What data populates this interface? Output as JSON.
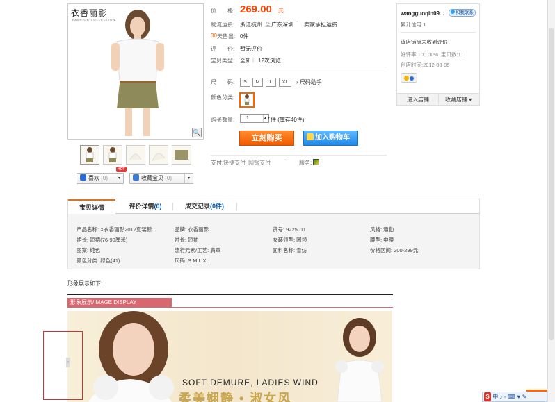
{
  "gallery": {
    "brand_logo": "衣香丽影",
    "brand_sub": "FASHION COLLECTION",
    "zoom_icon": "magnifier-icon",
    "thumbnail_count": 5
  },
  "actions": {
    "like_label": "喜欢",
    "like_count": "(0)",
    "fav_label": "收藏宝贝",
    "fav_count": "(0)",
    "hot_badge": "HOT"
  },
  "info": {
    "price_label": "价　　格:",
    "price": "269.00",
    "price_unit": "元",
    "shipping_label": "物流运费:",
    "shipping_from": "浙江杭州",
    "shipping_sep1": "至",
    "shipping_to": "广东深圳",
    "shipping_note": "卖家承担运费",
    "sold_days": "30",
    "sold_label": "天售出:",
    "sold_count": "0件",
    "review_label": "评　　价:",
    "review_value": "暂无评价",
    "type_label": "宝贝类型:",
    "type_value": "全新",
    "views": "12次浏览",
    "size_label": "尺　　码:",
    "sizes": [
      "S",
      "M",
      "L",
      "XL"
    ],
    "size_helper": "尺码助手",
    "color_label": "颜色分类:",
    "qty_label": "购买数量:",
    "qty_value": "1",
    "stock": "件 (库存40件)",
    "buy_now": "立刻购买",
    "add_to_cart": "加入购物车",
    "pay_label": "支付:",
    "pay_quick": "快捷支付",
    "pay_bank": "网银支付",
    "service_label": "服务:"
  },
  "shop": {
    "seller": "wangguoqin09...",
    "contact": "和我联系",
    "credit_label": "累计信用:",
    "credit_value": "1",
    "no_review": "该店铺尚未收到评价",
    "positive_rate": "好评率:100.00%",
    "item_count": "宝贝数:11",
    "created": "创店时间:2012-03-05",
    "enter_shop": "进入店铺",
    "fav_shop": "收藏店铺"
  },
  "tabs": [
    {
      "label": "宝贝详情",
      "count": ""
    },
    {
      "label": "评价详情",
      "count": "(0)"
    },
    {
      "label": "成交记录",
      "count": "(0件)"
    }
  ],
  "attributes": [
    [
      "产品名称: X衣香丽影2012夏装新...",
      "品牌: 衣香丽影",
      "货号: 9225011",
      "风格: 通勤"
    ],
    [
      "裙长: 短裙(76-90厘米)",
      "袖长: 短袖",
      "女装领型: 圆领",
      "腰型: 中腰"
    ],
    [
      "图案: 纯色",
      "流行元素/工艺: 肩章",
      "面料名称: 雪纺",
      "价格区间: 200-299元"
    ],
    [
      "颜色分类: 绿色(41)",
      "尺码: S M L XL",
      "",
      ""
    ]
  ],
  "showcase": {
    "intro": "形象展示如下:",
    "tag": "形象展示/IMAGE DISPLAY",
    "slogan_en": "SOFT DEMURE, LADIES WIND",
    "slogan_zh": "柔美娴静 • 淑女风"
  },
  "ime": {
    "logo": "S",
    "text": "中 ♪ ◦ ⌨ ♥ ✎"
  },
  "colors": {
    "price": "#ff4400",
    "buy": "#f05a00",
    "cart": "#1f88e8",
    "tab_accent": "#ff6600",
    "banner": "#d96770"
  }
}
